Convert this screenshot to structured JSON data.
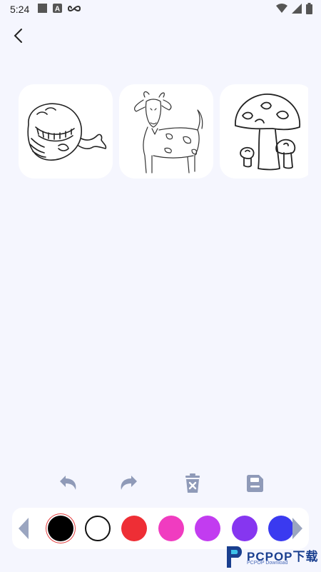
{
  "status_bar": {
    "time": "5:24",
    "icons": [
      "square-notification-icon",
      "a-notification-icon",
      "infinity-icon",
      "wifi-icon",
      "signal-icon",
      "battery-icon"
    ]
  },
  "header": {
    "back_icon": "chevron-left-icon"
  },
  "thumbnails": [
    {
      "subject": "whale"
    },
    {
      "subject": "goat"
    },
    {
      "subject": "mushroom"
    }
  ],
  "toolbar": {
    "icons": [
      "undo-icon",
      "redo-icon",
      "delete-icon",
      "save-icon"
    ],
    "color": "#8f9ab8"
  },
  "palette": {
    "selected_index": 0,
    "colors": [
      "#000000",
      "#ffffff",
      "#ee2e35",
      "#f03cc0",
      "#c23cf0",
      "#8636f0",
      "#3a3af0"
    ],
    "arrow_color": "#9aa5c0"
  },
  "watermark": {
    "title": "PCPOP下载",
    "subtitle": "PCPOP Download"
  }
}
